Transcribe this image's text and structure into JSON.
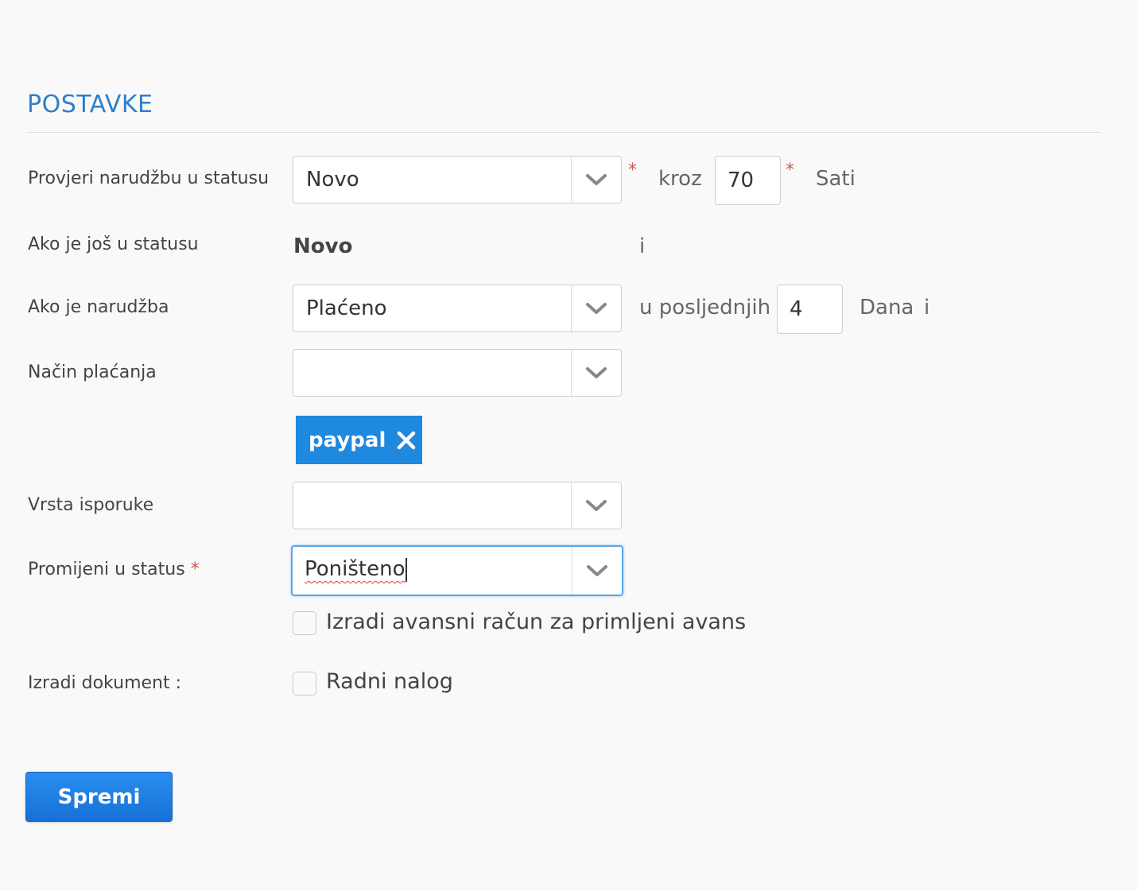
{
  "section": {
    "title": "POSTAVKE"
  },
  "rows": {
    "check_order": {
      "label": "Provjeri narudžbu u statusu",
      "status_value": "Novo",
      "through_label": "kroz",
      "hours_value": "70",
      "hours_unit": "Sati"
    },
    "if_still": {
      "label": "Ako je još u statusu",
      "status_value": "Novo",
      "and_label": "i"
    },
    "if_order": {
      "label": "Ako je narudžba",
      "status_value": "Plaćeno",
      "in_last_label": "u posljednjih",
      "days_value": "4",
      "days_unit": "Dana",
      "and_label": "i"
    },
    "payment_method": {
      "label": "Način plaćanja",
      "value": "",
      "selected_tag": "paypal"
    },
    "delivery_type": {
      "label": "Vrsta isporuke",
      "value": ""
    },
    "change_status": {
      "label": "Promijeni u status",
      "required_mark": "*",
      "value": "Poništeno"
    },
    "advance_invoice": {
      "label": "Izradi avansni račun za primljeni avans",
      "checked": false
    },
    "create_document": {
      "label": "Izradi dokument :",
      "option_label": "Radni nalog",
      "checked": false
    }
  },
  "required_mark": "*",
  "save_button": {
    "label": "Spremi"
  },
  "colors": {
    "accent": "#2f7fc9",
    "required": "#d9534f",
    "tag": "#1f88df",
    "button": "#1f7ee3",
    "focus": "#5aa6e8"
  },
  "icons": {
    "dropdown": "chevron-down-icon",
    "tag_remove": "close-icon"
  }
}
